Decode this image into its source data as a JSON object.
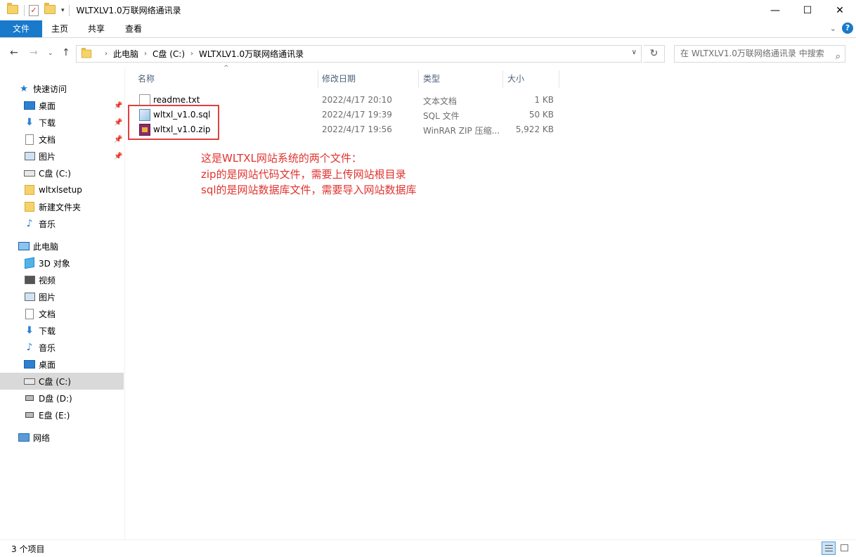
{
  "window": {
    "title": "WLTXLV1.0万联网络通讯录",
    "minimize": "—",
    "maximize": "☐",
    "close": "✕"
  },
  "ribbon": {
    "tabs": [
      "文件",
      "主页",
      "共享",
      "查看"
    ]
  },
  "address": {
    "crumbs": [
      "此电脑",
      "C盘 (C:)",
      "WLTXLV1.0万联网络通讯录"
    ],
    "search_placeholder": "在 WLTXLV1.0万联网络通讯录 中搜索"
  },
  "sidebar": {
    "quick_access": "快速访问",
    "quick_items": [
      "桌面",
      "下载",
      "文档",
      "图片",
      "C盘 (C:)",
      "wltxlsetup",
      "新建文件夹",
      "音乐"
    ],
    "this_pc": "此电脑",
    "pc_items": [
      "3D 对象",
      "视频",
      "图片",
      "文档",
      "下载",
      "音乐",
      "桌面",
      "C盘 (C:)",
      "D盘 (D:)",
      "E盘 (E:)"
    ],
    "network": "网络"
  },
  "columns": {
    "name": "名称",
    "date": "修改日期",
    "type": "类型",
    "size": "大小"
  },
  "files": [
    {
      "name": "readme.txt",
      "date": "2022/4/17 20:10",
      "type": "文本文档",
      "size": "1 KB"
    },
    {
      "name": "wltxl_v1.0.sql",
      "date": "2022/4/17 19:39",
      "type": "SQL 文件",
      "size": "50 KB"
    },
    {
      "name": "wltxl_v1.0.zip",
      "date": "2022/4/17 19:56",
      "type": "WinRAR ZIP 压缩...",
      "size": "5,922 KB"
    }
  ],
  "annotation": {
    "line1": "这是WLTXL网站系统的两个文件：",
    "line2": "zip的是网站代码文件，需要上传网站根目录",
    "line3": "sql的是网站数据库文件，需要导入网站数据库",
    "color": "#e0332f"
  },
  "status": {
    "count": "3 个项目"
  },
  "colors": {
    "accent": "#1979ca"
  }
}
